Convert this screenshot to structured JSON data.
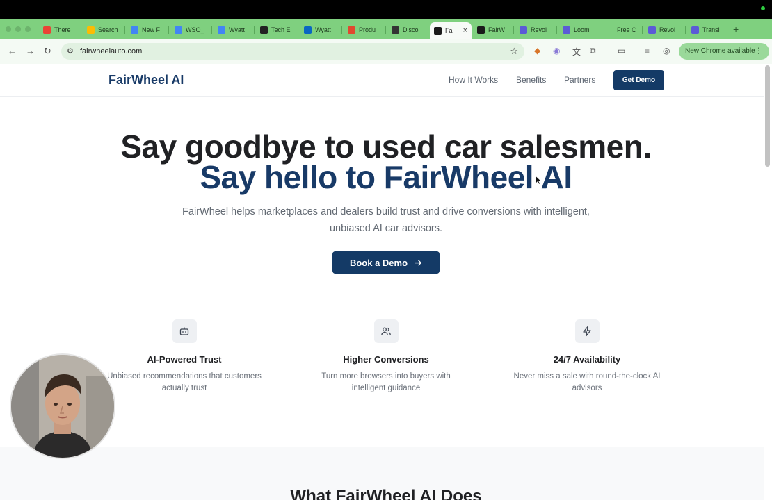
{
  "browser": {
    "tabs": [
      {
        "label": "There",
        "color": "#ea4335"
      },
      {
        "label": "Search",
        "color": "#fbbc04"
      },
      {
        "label": "New F",
        "color": "#4285f4"
      },
      {
        "label": "WSO_",
        "color": "#4285f4"
      },
      {
        "label": "Wyatt",
        "color": "#4285f4"
      },
      {
        "label": "Tech E",
        "color": "#222222"
      },
      {
        "label": "Wyatt",
        "color": "#0a66c2"
      },
      {
        "label": "Produ",
        "color": "#e0492f"
      },
      {
        "label": "Disco",
        "color": "#333333"
      },
      {
        "label": "Fa",
        "color": "#1a1a1a",
        "active": true
      },
      {
        "label": "FairW",
        "color": "#1a1a1a"
      },
      {
        "label": "Revol",
        "color": "#5b5bd6"
      },
      {
        "label": "Loom",
        "color": "#5b5bd6"
      },
      {
        "label": "Free C",
        "color": "#7fd07f"
      },
      {
        "label": "Revol",
        "color": "#5b5bd6"
      },
      {
        "label": "Transl",
        "color": "#5b5bd6"
      }
    ],
    "new_tab": "+",
    "address": "fairwheelauto.com",
    "update_label": "New Chrome available"
  },
  "site": {
    "logo": "FairWheel AI",
    "nav": [
      "How It Works",
      "Benefits",
      "Partners"
    ],
    "cta": "Get Demo",
    "headline_1": "Say goodbye to used car salesmen.",
    "headline_2": "Say hello to FairWheel AI",
    "subhead": "FairWheel helps marketplaces and dealers build trust and drive conversions with intelligent, unbiased AI car advisors.",
    "book_demo": "Book a Demo",
    "features": [
      {
        "icon": "robot-icon",
        "title": "AI-Powered Trust",
        "desc": "Unbiased recommendations that customers actually trust"
      },
      {
        "icon": "users-icon",
        "title": "Higher Conversions",
        "desc": "Turn more browsers into buyers with intelligent guidance"
      },
      {
        "icon": "lightning-icon",
        "title": "24/7 Availability",
        "desc": "Never miss a sale with round-the-clock AI advisors"
      }
    ],
    "section_title": "What FairWheel AI Does"
  },
  "colors": {
    "brand": "#143a66",
    "chrome_green": "#7fd07f"
  }
}
